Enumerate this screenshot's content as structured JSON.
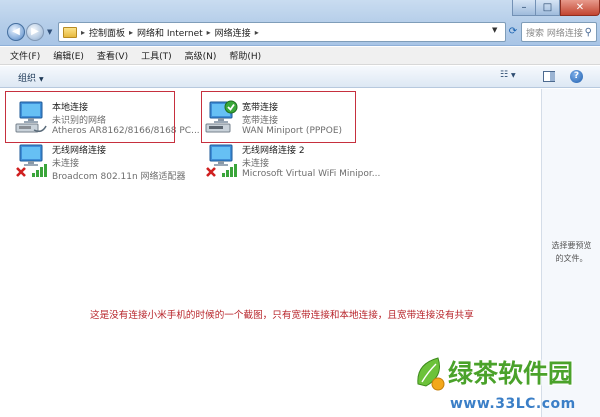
{
  "address": {
    "crumbs": [
      "控制面板",
      "网络和 Internet",
      "网络连接"
    ],
    "search_placeholder": "搜索 网络连接"
  },
  "menu": [
    "文件(F)",
    "编辑(E)",
    "查看(V)",
    "工具(T)",
    "高级(N)",
    "帮助(H)"
  ],
  "toolbar": {
    "organize_label": "组织"
  },
  "connections": [
    {
      "name": "本地连接",
      "status": "未识别的网络",
      "device": "Atheros AR8162/8166/8168 PC..."
    },
    {
      "name": "宽带连接",
      "status": "宽带连接",
      "device": "WAN Miniport (PPPOE)"
    },
    {
      "name": "无线网络连接",
      "status": "未连接",
      "device": "Broadcom 802.11n 网络适配器"
    },
    {
      "name": "无线网络连接 2",
      "status": "未连接",
      "device": "Microsoft Virtual WiFi Minipor..."
    }
  ],
  "annotation": "这是没有连接小米手机的时候的一个截图，只有宽带连接和本地连接，且宽带连接没有共享",
  "preview_pane": {
    "text": "选择要预览\n的文件。"
  },
  "watermark": {
    "brand": "绿茶软件园",
    "url": "www.33LC.com"
  },
  "colors": {
    "highlight": "#c6303e",
    "annotation": "#b8262c",
    "watermark_green": "#4aa22a",
    "watermark_blue": "#3b7fc7"
  }
}
